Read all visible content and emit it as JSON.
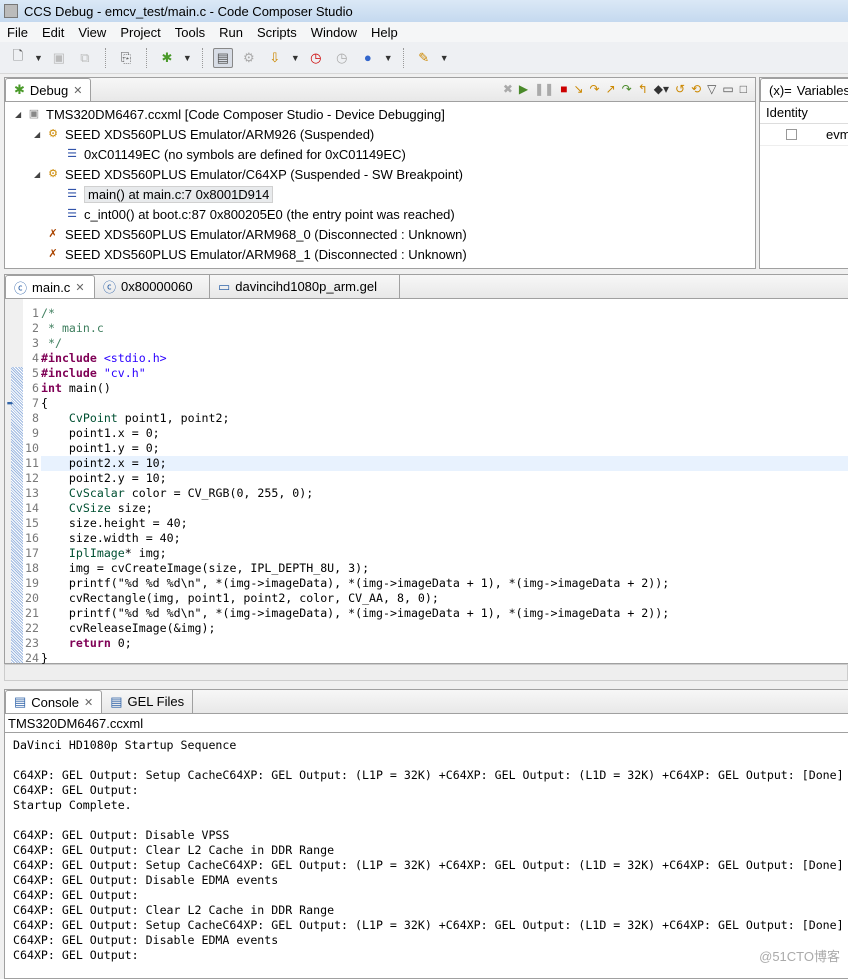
{
  "window": {
    "title": "CCS Debug - emcv_test/main.c - Code Composer Studio"
  },
  "menu": [
    "File",
    "Edit",
    "View",
    "Project",
    "Tools",
    "Run",
    "Scripts",
    "Window",
    "Help"
  ],
  "debug": {
    "tab": "Debug",
    "items": [
      {
        "label": "TMS320DM6467.ccxml [Code Composer Studio - Device Debugging]",
        "level": 0,
        "icon": "target-config-icon"
      },
      {
        "label": "SEED XDS560PLUS Emulator/ARM926 (Suspended)",
        "level": 1,
        "icon": "cpu-thread-icon"
      },
      {
        "label": "0xC01149EC  (no symbols are defined for 0xC01149EC)",
        "level": 2,
        "icon": "stack-frame-icon"
      },
      {
        "label": "SEED XDS560PLUS Emulator/C64XP (Suspended - SW Breakpoint)",
        "level": 1,
        "icon": "cpu-thread-icon"
      },
      {
        "label": "main() at main.c:7 0x8001D914",
        "level": 2,
        "icon": "stack-frame-icon",
        "selected": true
      },
      {
        "label": "c_int00() at boot.c:87 0x800205E0  (the entry point was reached)",
        "level": 2,
        "icon": "stack-frame-icon"
      },
      {
        "label": "SEED XDS560PLUS Emulator/ARM968_0 (Disconnected : Unknown)",
        "level": 1,
        "icon": "disconnected-cpu-icon"
      },
      {
        "label": "SEED XDS560PLUS Emulator/ARM968_1 (Disconnected : Unknown)",
        "level": 1,
        "icon": "disconnected-cpu-icon"
      }
    ]
  },
  "variables": {
    "tab": "Variables",
    "column": "Identity",
    "row": "evm"
  },
  "editor": {
    "tabs": [
      "main.c",
      "0x80000060",
      "davincihd1080p_arm.gel"
    ],
    "current_line": 11,
    "lines": [
      "/*",
      " * main.c",
      " */",
      "#include <stdio.h>",
      "#include \"cv.h\"",
      "int main()",
      "{",
      "    CvPoint point1, point2;",
      "    point1.x = 0;",
      "    point1.y = 0;",
      "    point2.x = 10;",
      "    point2.y = 10;",
      "    CvScalar color = CV_RGB(0, 255, 0);",
      "    CvSize size;",
      "    size.height = 40;",
      "    size.width = 40;",
      "    IplImage* img;",
      "    img = cvCreateImage(size, IPL_DEPTH_8U, 3);",
      "    printf(\"%d %d %d\\n\", *(img->imageData), *(img->imageData + 1), *(img->imageData + 2));",
      "    cvRectangle(img, point1, point2, color, CV_AA, 8, 0);",
      "    printf(\"%d %d %d\\n\", *(img->imageData), *(img->imageData + 1), *(img->imageData + 2));",
      "    cvReleaseImage(&img);",
      "    return 0;",
      "}"
    ]
  },
  "console": {
    "tabs": [
      "Console",
      "GEL Files"
    ],
    "header": "TMS320DM6467.ccxml",
    "lines": [
      "DaVinci HD1080p Startup Sequence",
      "",
      "C64XP: GEL Output: Setup CacheC64XP: GEL Output: (L1P = 32K) +C64XP: GEL Output: (L1D = 32K) +C64XP: GEL Output: [Done]",
      "C64XP: GEL Output: ",
      "Startup Complete.",
      "",
      "C64XP: GEL Output: Disable VPSS",
      "C64XP: GEL Output: Clear L2 Cache in DDR Range",
      "C64XP: GEL Output: Setup CacheC64XP: GEL Output: (L1P = 32K) +C64XP: GEL Output: (L1D = 32K) +C64XP: GEL Output: [Done]",
      "C64XP: GEL Output: Disable EDMA events",
      "C64XP: GEL Output: ",
      "C64XP: GEL Output: Clear L2 Cache in DDR Range",
      "C64XP: GEL Output: Setup CacheC64XP: GEL Output: (L1P = 32K) +C64XP: GEL Output: (L1D = 32K) +C64XP: GEL Output: [Done]",
      "C64XP: GEL Output: Disable EDMA events",
      "C64XP: GEL Output: "
    ]
  },
  "watermark": "@51CTO博客"
}
